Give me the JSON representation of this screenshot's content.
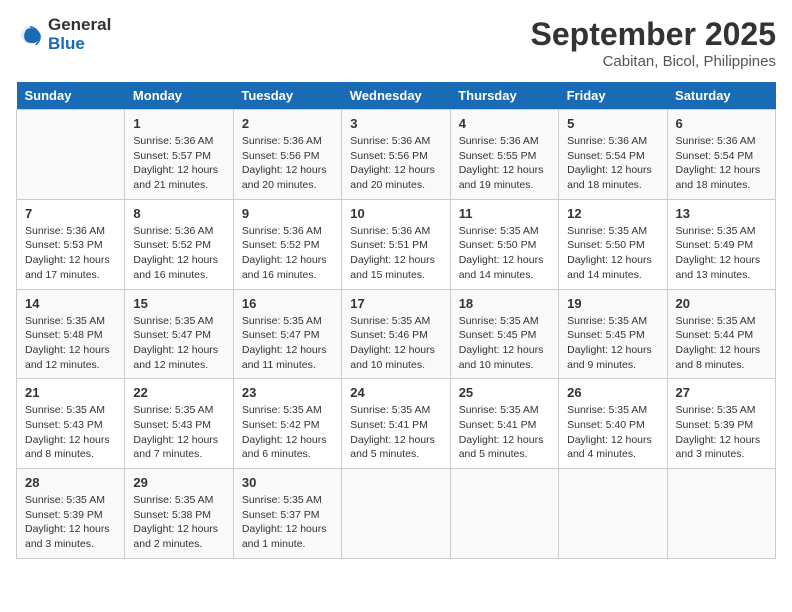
{
  "logo": {
    "line1": "General",
    "line2": "Blue"
  },
  "title": "September 2025",
  "subtitle": "Cabitan, Bicol, Philippines",
  "days_of_week": [
    "Sunday",
    "Monday",
    "Tuesday",
    "Wednesday",
    "Thursday",
    "Friday",
    "Saturday"
  ],
  "weeks": [
    [
      {
        "num": "",
        "info": ""
      },
      {
        "num": "1",
        "info": "Sunrise: 5:36 AM\nSunset: 5:57 PM\nDaylight: 12 hours\nand 21 minutes."
      },
      {
        "num": "2",
        "info": "Sunrise: 5:36 AM\nSunset: 5:56 PM\nDaylight: 12 hours\nand 20 minutes."
      },
      {
        "num": "3",
        "info": "Sunrise: 5:36 AM\nSunset: 5:56 PM\nDaylight: 12 hours\nand 20 minutes."
      },
      {
        "num": "4",
        "info": "Sunrise: 5:36 AM\nSunset: 5:55 PM\nDaylight: 12 hours\nand 19 minutes."
      },
      {
        "num": "5",
        "info": "Sunrise: 5:36 AM\nSunset: 5:54 PM\nDaylight: 12 hours\nand 18 minutes."
      },
      {
        "num": "6",
        "info": "Sunrise: 5:36 AM\nSunset: 5:54 PM\nDaylight: 12 hours\nand 18 minutes."
      }
    ],
    [
      {
        "num": "7",
        "info": "Sunrise: 5:36 AM\nSunset: 5:53 PM\nDaylight: 12 hours\nand 17 minutes."
      },
      {
        "num": "8",
        "info": "Sunrise: 5:36 AM\nSunset: 5:52 PM\nDaylight: 12 hours\nand 16 minutes."
      },
      {
        "num": "9",
        "info": "Sunrise: 5:36 AM\nSunset: 5:52 PM\nDaylight: 12 hours\nand 16 minutes."
      },
      {
        "num": "10",
        "info": "Sunrise: 5:36 AM\nSunset: 5:51 PM\nDaylight: 12 hours\nand 15 minutes."
      },
      {
        "num": "11",
        "info": "Sunrise: 5:35 AM\nSunset: 5:50 PM\nDaylight: 12 hours\nand 14 minutes."
      },
      {
        "num": "12",
        "info": "Sunrise: 5:35 AM\nSunset: 5:50 PM\nDaylight: 12 hours\nand 14 minutes."
      },
      {
        "num": "13",
        "info": "Sunrise: 5:35 AM\nSunset: 5:49 PM\nDaylight: 12 hours\nand 13 minutes."
      }
    ],
    [
      {
        "num": "14",
        "info": "Sunrise: 5:35 AM\nSunset: 5:48 PM\nDaylight: 12 hours\nand 12 minutes."
      },
      {
        "num": "15",
        "info": "Sunrise: 5:35 AM\nSunset: 5:47 PM\nDaylight: 12 hours\nand 12 minutes."
      },
      {
        "num": "16",
        "info": "Sunrise: 5:35 AM\nSunset: 5:47 PM\nDaylight: 12 hours\nand 11 minutes."
      },
      {
        "num": "17",
        "info": "Sunrise: 5:35 AM\nSunset: 5:46 PM\nDaylight: 12 hours\nand 10 minutes."
      },
      {
        "num": "18",
        "info": "Sunrise: 5:35 AM\nSunset: 5:45 PM\nDaylight: 12 hours\nand 10 minutes."
      },
      {
        "num": "19",
        "info": "Sunrise: 5:35 AM\nSunset: 5:45 PM\nDaylight: 12 hours\nand 9 minutes."
      },
      {
        "num": "20",
        "info": "Sunrise: 5:35 AM\nSunset: 5:44 PM\nDaylight: 12 hours\nand 8 minutes."
      }
    ],
    [
      {
        "num": "21",
        "info": "Sunrise: 5:35 AM\nSunset: 5:43 PM\nDaylight: 12 hours\nand 8 minutes."
      },
      {
        "num": "22",
        "info": "Sunrise: 5:35 AM\nSunset: 5:43 PM\nDaylight: 12 hours\nand 7 minutes."
      },
      {
        "num": "23",
        "info": "Sunrise: 5:35 AM\nSunset: 5:42 PM\nDaylight: 12 hours\nand 6 minutes."
      },
      {
        "num": "24",
        "info": "Sunrise: 5:35 AM\nSunset: 5:41 PM\nDaylight: 12 hours\nand 5 minutes."
      },
      {
        "num": "25",
        "info": "Sunrise: 5:35 AM\nSunset: 5:41 PM\nDaylight: 12 hours\nand 5 minutes."
      },
      {
        "num": "26",
        "info": "Sunrise: 5:35 AM\nSunset: 5:40 PM\nDaylight: 12 hours\nand 4 minutes."
      },
      {
        "num": "27",
        "info": "Sunrise: 5:35 AM\nSunset: 5:39 PM\nDaylight: 12 hours\nand 3 minutes."
      }
    ],
    [
      {
        "num": "28",
        "info": "Sunrise: 5:35 AM\nSunset: 5:39 PM\nDaylight: 12 hours\nand 3 minutes."
      },
      {
        "num": "29",
        "info": "Sunrise: 5:35 AM\nSunset: 5:38 PM\nDaylight: 12 hours\nand 2 minutes."
      },
      {
        "num": "30",
        "info": "Sunrise: 5:35 AM\nSunset: 5:37 PM\nDaylight: 12 hours\nand 1 minute."
      },
      {
        "num": "",
        "info": ""
      },
      {
        "num": "",
        "info": ""
      },
      {
        "num": "",
        "info": ""
      },
      {
        "num": "",
        "info": ""
      }
    ]
  ]
}
